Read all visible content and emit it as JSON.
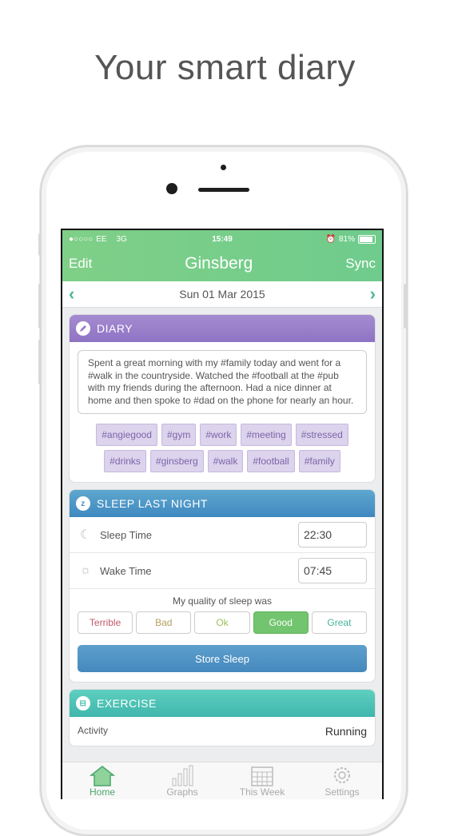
{
  "headline": "Your smart diary",
  "status_bar": {
    "carrier": "EE",
    "network": "3G",
    "time": "15:49",
    "battery": "81%"
  },
  "nav": {
    "edit": "Edit",
    "title": "Ginsberg",
    "sync": "Sync"
  },
  "date": {
    "label": "Sun 01 Mar 2015"
  },
  "diary": {
    "title": "DIARY",
    "text": "Spent a great morning with my #family today and went for a #walk in the countryside. Watched the #football at the #pub with my friends during the afternoon. Had a nice dinner at home and then spoke to #dad on the phone for nearly an hour.",
    "tags": [
      "#angiegood",
      "#gym",
      "#work",
      "#meeting",
      "#stressed",
      "#drinks",
      "#ginsberg",
      "#walk",
      "#football",
      "#family"
    ]
  },
  "sleep": {
    "title": "SLEEP LAST NIGHT",
    "sleep_time_label": "Sleep Time",
    "sleep_time_value": "22:30",
    "wake_time_label": "Wake Time",
    "wake_time_value": "07:45",
    "quality_label": "My quality of sleep was",
    "qualities": [
      "Terrible",
      "Bad",
      "Ok",
      "Good",
      "Great"
    ],
    "selected_quality": "Good",
    "store_button": "Store Sleep"
  },
  "exercise": {
    "title": "EXERCISE",
    "activity_label": "Activity",
    "activity_value": "Running"
  },
  "tabbar": {
    "tabs": [
      "Home",
      "Graphs",
      "This Week",
      "Settings"
    ],
    "active": "Home"
  },
  "colors": {
    "accent_green": "#6fcc8c",
    "diary_purple": "#9a7fcb",
    "sleep_blue": "#4a90c4",
    "exercise_teal": "#46bdb2",
    "q_terrible": "#c05a6a",
    "q_bad": "#b3a060",
    "q_ok": "#9cbf5a",
    "q_good": "#6fc46f",
    "q_great": "#45b59a"
  }
}
